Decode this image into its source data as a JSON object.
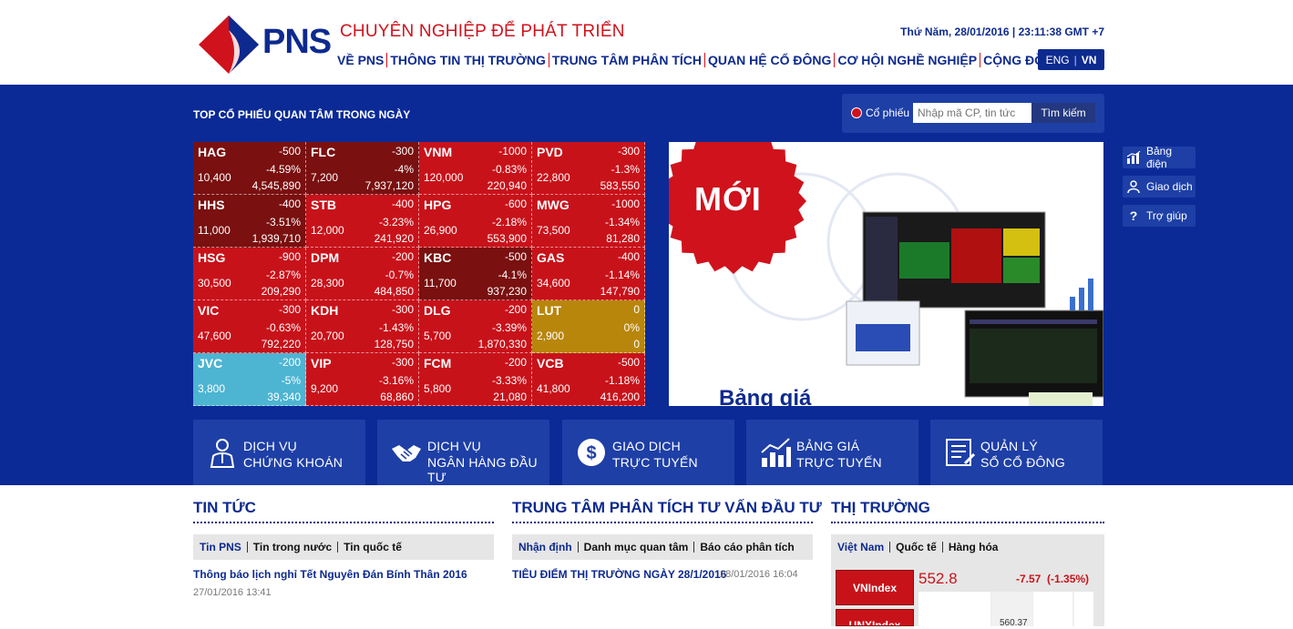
{
  "header": {
    "logo_text": "PNS",
    "slogan": "CHUYÊN NGHIỆP ĐỂ PHÁT TRIỂN",
    "datetime": "Thứ Năm, 28/01/2016 | 23:11:38 GMT +7",
    "nav": [
      "VỀ PNS",
      "THÔNG TIN THỊ TRƯỜNG",
      "TRUNG TÂM PHÂN TÍCH",
      "QUAN HỆ CỔ ĐÔNG",
      "CƠ HỘI NGHỀ NGHIỆP",
      "CỘNG ĐỒNG"
    ],
    "lang_eng": "ENG",
    "lang_vn": "VN"
  },
  "top_stocks": {
    "title": "TOP CỔ PHIẾU QUAN TÂM TRONG NGÀY",
    "cells": [
      {
        "sym": "HAG",
        "chg": "-500",
        "pct": "-4.59%",
        "price": "10,400",
        "vol": "4,545,890",
        "tone": "c-dark"
      },
      {
        "sym": "FLC",
        "chg": "-300",
        "pct": "-4%",
        "price": "7,200",
        "vol": "7,937,120",
        "tone": "c-dark"
      },
      {
        "sym": "VNM",
        "chg": "-1000",
        "pct": "-0.83%",
        "price": "120,000",
        "vol": "220,940",
        "tone": "c-red"
      },
      {
        "sym": "PVD",
        "chg": "-300",
        "pct": "-1.3%",
        "price": "22,800",
        "vol": "583,550",
        "tone": "c-red"
      },
      {
        "sym": "HHS",
        "chg": "-400",
        "pct": "-3.51%",
        "price": "11,000",
        "vol": "1,939,710",
        "tone": "c-dark"
      },
      {
        "sym": "STB",
        "chg": "-400",
        "pct": "-3.23%",
        "price": "12,000",
        "vol": "241,920",
        "tone": "c-red"
      },
      {
        "sym": "HPG",
        "chg": "-600",
        "pct": "-2.18%",
        "price": "26,900",
        "vol": "553,900",
        "tone": "c-red"
      },
      {
        "sym": "MWG",
        "chg": "-1000",
        "pct": "-1.34%",
        "price": "73,500",
        "vol": "81,280",
        "tone": "c-red"
      },
      {
        "sym": "HSG",
        "chg": "-900",
        "pct": "-2.87%",
        "price": "30,500",
        "vol": "209,290",
        "tone": "c-red"
      },
      {
        "sym": "DPM",
        "chg": "-200",
        "pct": "-0.7%",
        "price": "28,300",
        "vol": "484,850",
        "tone": "c-red"
      },
      {
        "sym": "KBC",
        "chg": "-500",
        "pct": "-4.1%",
        "price": "11,700",
        "vol": "937,230",
        "tone": "c-dark"
      },
      {
        "sym": "GAS",
        "chg": "-400",
        "pct": "-1.14%",
        "price": "34,600",
        "vol": "147,790",
        "tone": "c-red"
      },
      {
        "sym": "VIC",
        "chg": "-300",
        "pct": "-0.63%",
        "price": "47,600",
        "vol": "792,220",
        "tone": "c-red"
      },
      {
        "sym": "KDH",
        "chg": "-300",
        "pct": "-1.43%",
        "price": "20,700",
        "vol": "128,750",
        "tone": "c-red"
      },
      {
        "sym": "DLG",
        "chg": "-200",
        "pct": "-3.39%",
        "price": "5,700",
        "vol": "1,870,330",
        "tone": "c-red"
      },
      {
        "sym": "LUT",
        "chg": "0",
        "pct": "0%",
        "price": "2,900",
        "vol": "0",
        "tone": "c-gold"
      },
      {
        "sym": "JVC",
        "chg": "-200",
        "pct": "-5%",
        "price": "3,800",
        "vol": "39,340",
        "tone": "c-cyan"
      },
      {
        "sym": "VIP",
        "chg": "-300",
        "pct": "-3.16%",
        "price": "9,200",
        "vol": "68,860",
        "tone": "c-red"
      },
      {
        "sym": "FCM",
        "chg": "-200",
        "pct": "-3.33%",
        "price": "5,800",
        "vol": "21,080",
        "tone": "c-red"
      },
      {
        "sym": "VCB",
        "chg": "-500",
        "pct": "-1.18%",
        "price": "41,800",
        "vol": "416,200",
        "tone": "c-red"
      }
    ]
  },
  "search": {
    "radio_label": "Cổ phiếu",
    "placeholder": "Nhập mã CP, tin tức",
    "button": "Tìm kiếm"
  },
  "banner": {
    "badge": "MỚI",
    "heading": "Bảng giá"
  },
  "side_tools": [
    {
      "label": "Bảng điện",
      "icon": "chart-icon"
    },
    {
      "label": "Giao dịch",
      "icon": "user-icon"
    },
    {
      "label": "Trợ giúp",
      "icon": "help-icon"
    }
  ],
  "services": [
    {
      "line1": "DỊCH VỤ",
      "line2": "CHỨNG KHOÁN",
      "icon": "broker-icon"
    },
    {
      "line1": "DỊCH VỤ",
      "line2": "NGÂN HÀNG ĐẦU TƯ",
      "icon": "handshake-icon"
    },
    {
      "line1": "GIAO DỊCH",
      "line2": "TRỰC TUYẾN",
      "icon": "dollar-icon"
    },
    {
      "line1": "BẢNG GIÁ",
      "line2": "TRỰC TUYẾN",
      "icon": "bar-chart-icon"
    },
    {
      "line1": "QUẢN LÝ",
      "line2": "SỔ CỔ ĐÔNG",
      "icon": "ledger-icon"
    }
  ],
  "news": {
    "title": "TIN TỨC",
    "tabs": [
      "Tin PNS",
      "Tin trong nước",
      "Tin quốc tế"
    ],
    "item_title": "Thông báo lịch nghỉ Tết Nguyên Đán Bính Thân 2016",
    "item_date": "27/01/2016 13:41"
  },
  "analysis": {
    "title": "TRUNG TÂM PHÂN TÍCH TƯ VẤN ĐẦU TƯ",
    "tabs": [
      "Nhận định",
      "Danh mục quan tâm",
      "Báo cáo phân tích"
    ],
    "item_title": "TIÊU ĐIỂM THỊ TRƯỜNG NGÀY 28/1/2016",
    "item_date": "28/01/2016 16:04"
  },
  "market": {
    "title": "THỊ TRƯỜNG",
    "tabs": [
      "Việt Nam",
      "Quốc tế",
      "Hàng hóa"
    ],
    "index1": "VNIndex",
    "index2": "UNXIndex",
    "value": "552.8",
    "change": "-7.57",
    "change_pct": "(-1.35%)",
    "chart_label": "560.37"
  },
  "colors": {
    "brand_blue": "#0b2a96",
    "brand_red": "#d0121c"
  }
}
